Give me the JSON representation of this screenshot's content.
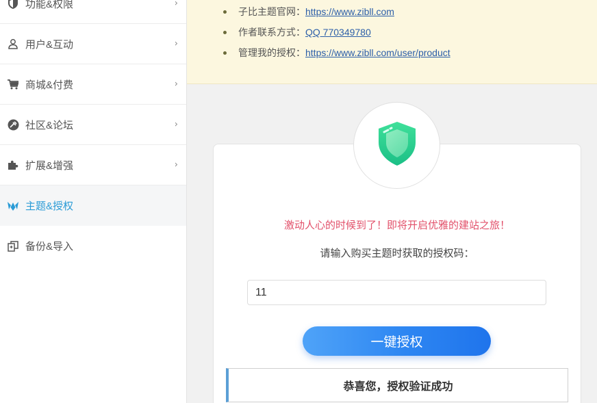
{
  "sidebar": {
    "items": [
      {
        "label": "功能&权限",
        "icon": "shield-half-icon"
      },
      {
        "label": "用户&互动",
        "icon": "user-icon"
      },
      {
        "label": "商城&付费",
        "icon": "cart-icon"
      },
      {
        "label": "社区&论坛",
        "icon": "forum-icon"
      },
      {
        "label": "扩展&增强",
        "icon": "puzzle-icon"
      },
      {
        "label": "主题&授权",
        "icon": "theme-logo-icon",
        "active": true
      },
      {
        "label": "备份&导入",
        "icon": "backup-icon"
      }
    ],
    "active_color": "#2a9bd6"
  },
  "notice": {
    "lines": [
      {
        "label": "子比主题官网：",
        "link": "https://www.zibll.com"
      },
      {
        "label": "作者联系方式：",
        "link": "QQ 770349780"
      },
      {
        "label": "管理我的授权：",
        "link": "https://www.zibll.com/user/product"
      }
    ]
  },
  "auth": {
    "tagline": "激动人心的时候到了！即将开启优雅的建站之旅！",
    "prompt": "请输入购买主题时获取的授权码：",
    "code_value": "11",
    "button_label": "一键授权",
    "success_message": "恭喜您，授权验证成功"
  },
  "colors": {
    "tagline": "#e2506a",
    "button_start": "#4fa3f8",
    "button_end": "#1f74ec",
    "notice_bg": "#fcf7df"
  }
}
